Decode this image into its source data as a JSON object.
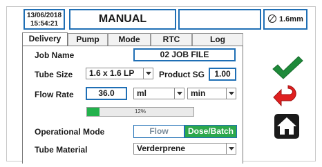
{
  "header": {
    "date": "13/06/2018",
    "time": "15:54:21",
    "mode_title": "MANUAL",
    "tube_size_badge": "1.6mm"
  },
  "tabs": [
    {
      "label": "Delivery",
      "active": true
    },
    {
      "label": "Pump",
      "active": false
    },
    {
      "label": "Mode",
      "active": false
    },
    {
      "label": "RTC",
      "active": false
    },
    {
      "label": "Log",
      "active": false
    }
  ],
  "delivery": {
    "job_name_label": "Job Name",
    "job_name_value": "02 JOB FILE",
    "tube_size_label": "Tube Size",
    "tube_size_value": "1.6 x 1.6 LP",
    "product_sg_label": "Product SG",
    "product_sg_value": "1.00",
    "flow_rate_label": "Flow Rate",
    "flow_rate_value": "36.0",
    "flow_unit_volume": "ml",
    "flow_unit_time": "min",
    "progress_text": "12%",
    "progress_fraction": 0.12,
    "operational_mode_label": "Operational Mode",
    "mode_option_flow": "Flow",
    "mode_option_dose": "Dose/Batch",
    "tube_material_label": "Tube Material",
    "tube_material_value": "Verderprene"
  },
  "side_buttons": {
    "confirm_icon": "checkmark-icon",
    "back_icon": "back-arrow-icon",
    "home_icon": "home-icon"
  },
  "colors": {
    "accent_blue": "#1f6fb5",
    "active_green": "#2ca84c",
    "check_green": "#1e8a3a",
    "back_red": "#e02020"
  }
}
